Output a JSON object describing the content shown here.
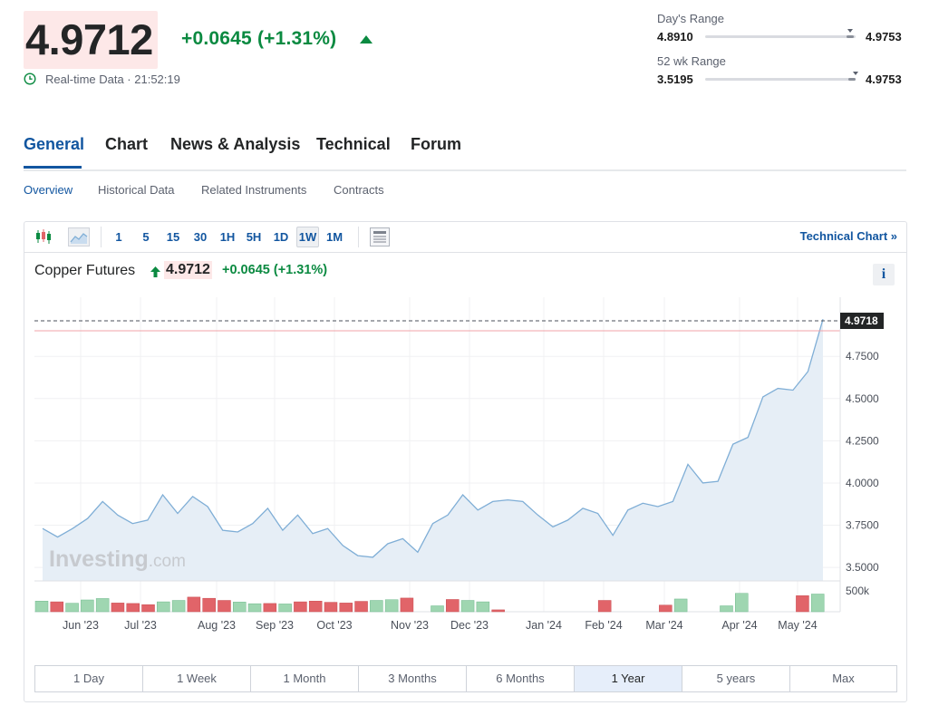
{
  "quote": {
    "price": "4.9712",
    "change": "+0.0645",
    "change_pct": "(+1.31%)",
    "realtime_label": "Real-time Data · 21:52:19"
  },
  "ranges": {
    "day": {
      "label": "Day's Range",
      "low": "4.8910",
      "high": "4.9753",
      "position": 0.97
    },
    "week52": {
      "label": "52 wk Range",
      "low": "3.5195",
      "high": "4.9753",
      "position": 0.97
    }
  },
  "tabs": [
    {
      "label": "General",
      "active": true
    },
    {
      "label": "Chart"
    },
    {
      "label": "News & Analysis"
    },
    {
      "label": "Technical"
    },
    {
      "label": "Forum"
    }
  ],
  "subtabs": [
    {
      "label": "Overview",
      "active": true
    },
    {
      "label": "Historical Data"
    },
    {
      "label": "Related Instruments"
    },
    {
      "label": "Contracts"
    }
  ],
  "toolbar": {
    "intervals": [
      "1",
      "5",
      "15",
      "30",
      "1H",
      "5H",
      "1D",
      "1W",
      "1M"
    ],
    "selected_interval": "1W",
    "technical_chart_label": "Technical Chart »"
  },
  "chart_header": {
    "name": "Copper Futures",
    "price": "4.9712",
    "change": "+0.0645",
    "change_pct": "(+1.31%)",
    "info_label": "i"
  },
  "watermark": {
    "brand": "Investing",
    "suffix": ".com"
  },
  "colors": {
    "accent": "#1256a0",
    "positive": "#0b8a41",
    "volume_up": "#9fd6b1",
    "volume_down": "#e16469",
    "area_fill": "#e6eef6",
    "line": "#7faed6"
  },
  "chart_data": {
    "type": "area",
    "title": "Copper Futures",
    "last_price_label": "4.9718",
    "y_ticks": [
      "4.7500",
      "4.5000",
      "4.2500",
      "4.0000",
      "3.7500",
      "3.5000"
    ],
    "ylim": [
      3.42,
      5.1
    ],
    "x_labels": [
      "Jun '23",
      "Jul '23",
      "Aug '23",
      "Sep '23",
      "Oct '23",
      "Nov '23",
      "Dec '23",
      "Jan '24",
      "Feb '24",
      "Mar '24",
      "Apr '24",
      "May '24"
    ],
    "values": [
      3.73,
      3.68,
      3.73,
      3.79,
      3.89,
      3.81,
      3.76,
      3.78,
      3.93,
      3.82,
      3.92,
      3.86,
      3.72,
      3.71,
      3.76,
      3.85,
      3.72,
      3.81,
      3.7,
      3.73,
      3.63,
      3.57,
      3.56,
      3.64,
      3.67,
      3.59,
      3.76,
      3.81,
      3.93,
      3.84,
      3.89,
      3.9,
      3.89,
      3.81,
      3.74,
      3.78,
      3.85,
      3.82,
      3.69,
      3.84,
      3.88,
      3.86,
      3.89,
      4.11,
      4.0,
      4.01,
      4.23,
      4.27,
      4.51,
      4.56,
      4.55,
      4.66,
      4.97
    ],
    "volume_label": "500k",
    "volume": [
      {
        "v": 0.45,
        "dir": "up"
      },
      {
        "v": 0.42,
        "dir": "down"
      },
      {
        "v": 0.36,
        "dir": "up"
      },
      {
        "v": 0.5,
        "dir": "up"
      },
      {
        "v": 0.56,
        "dir": "up"
      },
      {
        "v": 0.37,
        "dir": "down"
      },
      {
        "v": 0.35,
        "dir": "down"
      },
      {
        "v": 0.3,
        "dir": "down"
      },
      {
        "v": 0.42,
        "dir": "up"
      },
      {
        "v": 0.48,
        "dir": "up"
      },
      {
        "v": 0.62,
        "dir": "down"
      },
      {
        "v": 0.57,
        "dir": "down"
      },
      {
        "v": 0.48,
        "dir": "down"
      },
      {
        "v": 0.41,
        "dir": "up"
      },
      {
        "v": 0.34,
        "dir": "up"
      },
      {
        "v": 0.35,
        "dir": "down"
      },
      {
        "v": 0.33,
        "dir": "up"
      },
      {
        "v": 0.42,
        "dir": "down"
      },
      {
        "v": 0.45,
        "dir": "down"
      },
      {
        "v": 0.4,
        "dir": "down"
      },
      {
        "v": 0.37,
        "dir": "down"
      },
      {
        "v": 0.44,
        "dir": "down"
      },
      {
        "v": 0.48,
        "dir": "up"
      },
      {
        "v": 0.51,
        "dir": "up"
      },
      {
        "v": 0.58,
        "dir": "down"
      },
      {
        "v": 0,
        "dir": "up"
      },
      {
        "v": 0.25,
        "dir": "up"
      },
      {
        "v": 0.52,
        "dir": "down"
      },
      {
        "v": 0.48,
        "dir": "up"
      },
      {
        "v": 0.42,
        "dir": "up"
      },
      {
        "v": 0.08,
        "dir": "down"
      },
      {
        "v": 0,
        "dir": "up"
      },
      {
        "v": 0,
        "dir": "up"
      },
      {
        "v": 0,
        "dir": "up"
      },
      {
        "v": 0,
        "dir": "up"
      },
      {
        "v": 0,
        "dir": "up"
      },
      {
        "v": 0,
        "dir": "up"
      },
      {
        "v": 0.48,
        "dir": "down"
      },
      {
        "v": 0,
        "dir": "up"
      },
      {
        "v": 0,
        "dir": "up"
      },
      {
        "v": 0,
        "dir": "up"
      },
      {
        "v": 0.28,
        "dir": "down"
      },
      {
        "v": 0.54,
        "dir": "up"
      },
      {
        "v": 0,
        "dir": "up"
      },
      {
        "v": 0,
        "dir": "up"
      },
      {
        "v": 0.25,
        "dir": "up"
      },
      {
        "v": 0.78,
        "dir": "up"
      },
      {
        "v": 0,
        "dir": "up"
      },
      {
        "v": 0,
        "dir": "up"
      },
      {
        "v": 0,
        "dir": "up"
      },
      {
        "v": 0.68,
        "dir": "down"
      },
      {
        "v": 0.75,
        "dir": "up"
      },
      {
        "v": 0,
        "dir": "up"
      }
    ],
    "grid": true
  },
  "periods": [
    {
      "label": "1 Day"
    },
    {
      "label": "1 Week"
    },
    {
      "label": "1 Month"
    },
    {
      "label": "3 Months"
    },
    {
      "label": "6 Months"
    },
    {
      "label": "1 Year",
      "selected": true
    },
    {
      "label": "5 years"
    },
    {
      "label": "Max"
    }
  ]
}
